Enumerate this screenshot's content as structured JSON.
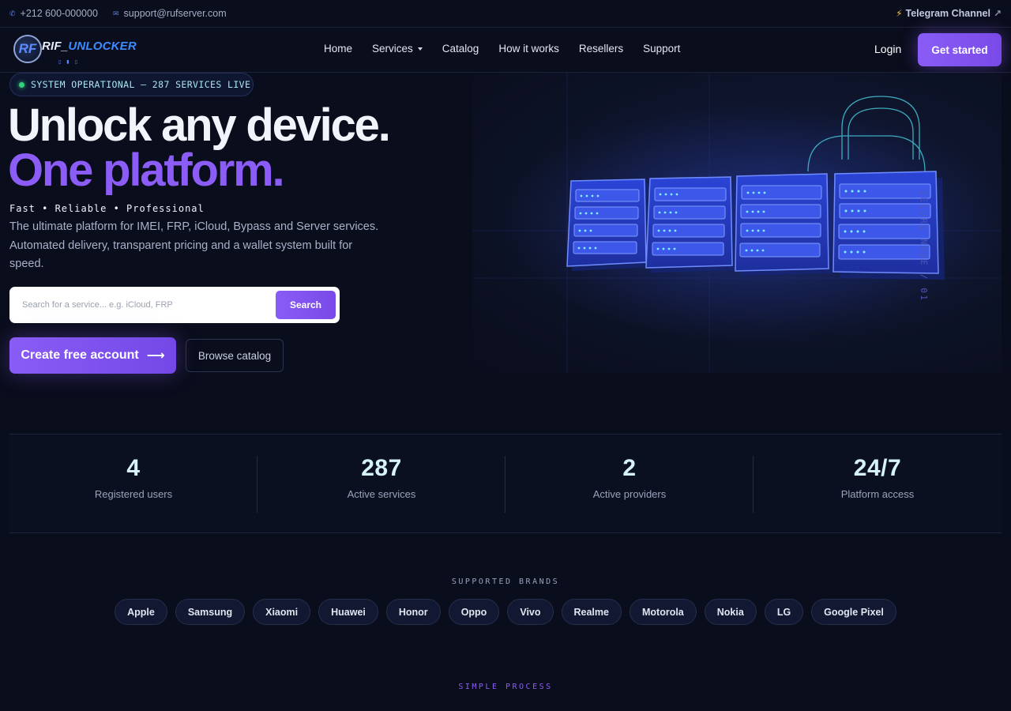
{
  "topbar": {
    "phone": "+212 600-000000",
    "email": "support@rufserver.com",
    "telegram_label": "Telegram Channel"
  },
  "logo": {
    "mark": "RF",
    "word_a": "RIF_",
    "word_b": "UNLOCKER"
  },
  "nav": {
    "items": [
      "Home",
      "Services",
      "Catalog",
      "How it works",
      "Resellers",
      "Support"
    ],
    "login": "Login",
    "get_started": "Get started"
  },
  "hero": {
    "badge": "SYSTEM OPERATIONAL — 287 SERVICES LIVE",
    "headline_1": "Unlock any device.",
    "headline_2": "One platform.",
    "tagline": "Fast • Reliable • Professional",
    "lead": "The ultimate platform for IMEI, FRP, iCloud, Bypass and Server services. Automated delivery, transparent pricing and a wallet system built for speed.",
    "search_placeholder": "Search for a service... e.g. iCloud, FRP",
    "search_button": "Search",
    "cta_primary": "Create free account",
    "cta_secondary": "Browse catalog",
    "side_label": "SECURE NODE / 01"
  },
  "stats": [
    {
      "value": "4",
      "label": "Registered users"
    },
    {
      "value": "287",
      "label": "Active services"
    },
    {
      "value": "2",
      "label": "Active providers"
    },
    {
      "value": "24/7",
      "label": "Platform access"
    }
  ],
  "brands": {
    "label": "SUPPORTED BRANDS",
    "items": [
      "Apple",
      "Samsung",
      "Xiaomi",
      "Huawei",
      "Honor",
      "Oppo",
      "Vivo",
      "Realme",
      "Motorola",
      "Nokia",
      "LG",
      "Google Pixel"
    ]
  },
  "process": {
    "label": "SIMPLE PROCESS"
  },
  "colors": {
    "accent": "#8b5cf6",
    "background": "#0a0d1c",
    "status_ok": "#34d17b",
    "server_glow": "#3b55ff"
  },
  "icons": [
    "phone-icon",
    "mail-icon",
    "lightning-icon",
    "external-link-icon",
    "chevron-down-icon",
    "arrow-right-icon",
    "status-dot-icon",
    "padlock-icon",
    "server-rack-icon"
  ]
}
